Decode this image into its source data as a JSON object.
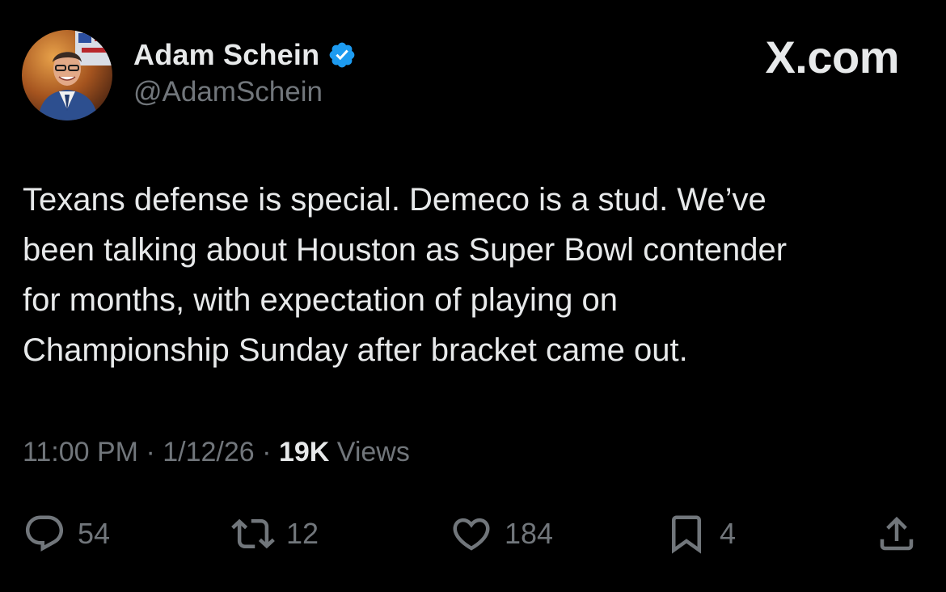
{
  "author": {
    "display_name": "Adam Schein",
    "handle": "@AdamSchein",
    "verified": true,
    "verified_color": "#1d9bf0"
  },
  "brand": {
    "label": "X.com"
  },
  "tweet": {
    "text_lines": [
      "Texans defense is special. Demeco is a stud. We’ve",
      "been talking about Houston as Super Bowl contender",
      "for months, with expectation of playing on",
      "Championship Sunday after bracket came out."
    ]
  },
  "meta": {
    "time": "11:00 PM",
    "separator": "·",
    "date": "1/12/26",
    "views_count": "19K",
    "views_label": "Views"
  },
  "actions": {
    "replies": {
      "icon": "reply-icon",
      "count": "54"
    },
    "reposts": {
      "icon": "repost-icon",
      "count": "12"
    },
    "likes": {
      "icon": "heart-icon",
      "count": "184"
    },
    "bookmarks": {
      "icon": "bookmark-icon",
      "count": "4"
    },
    "share": {
      "icon": "share-icon"
    }
  },
  "colors": {
    "background": "#000000",
    "text_primary": "#e7e9ea",
    "text_secondary": "#71767b",
    "accent": "#1d9bf0"
  }
}
